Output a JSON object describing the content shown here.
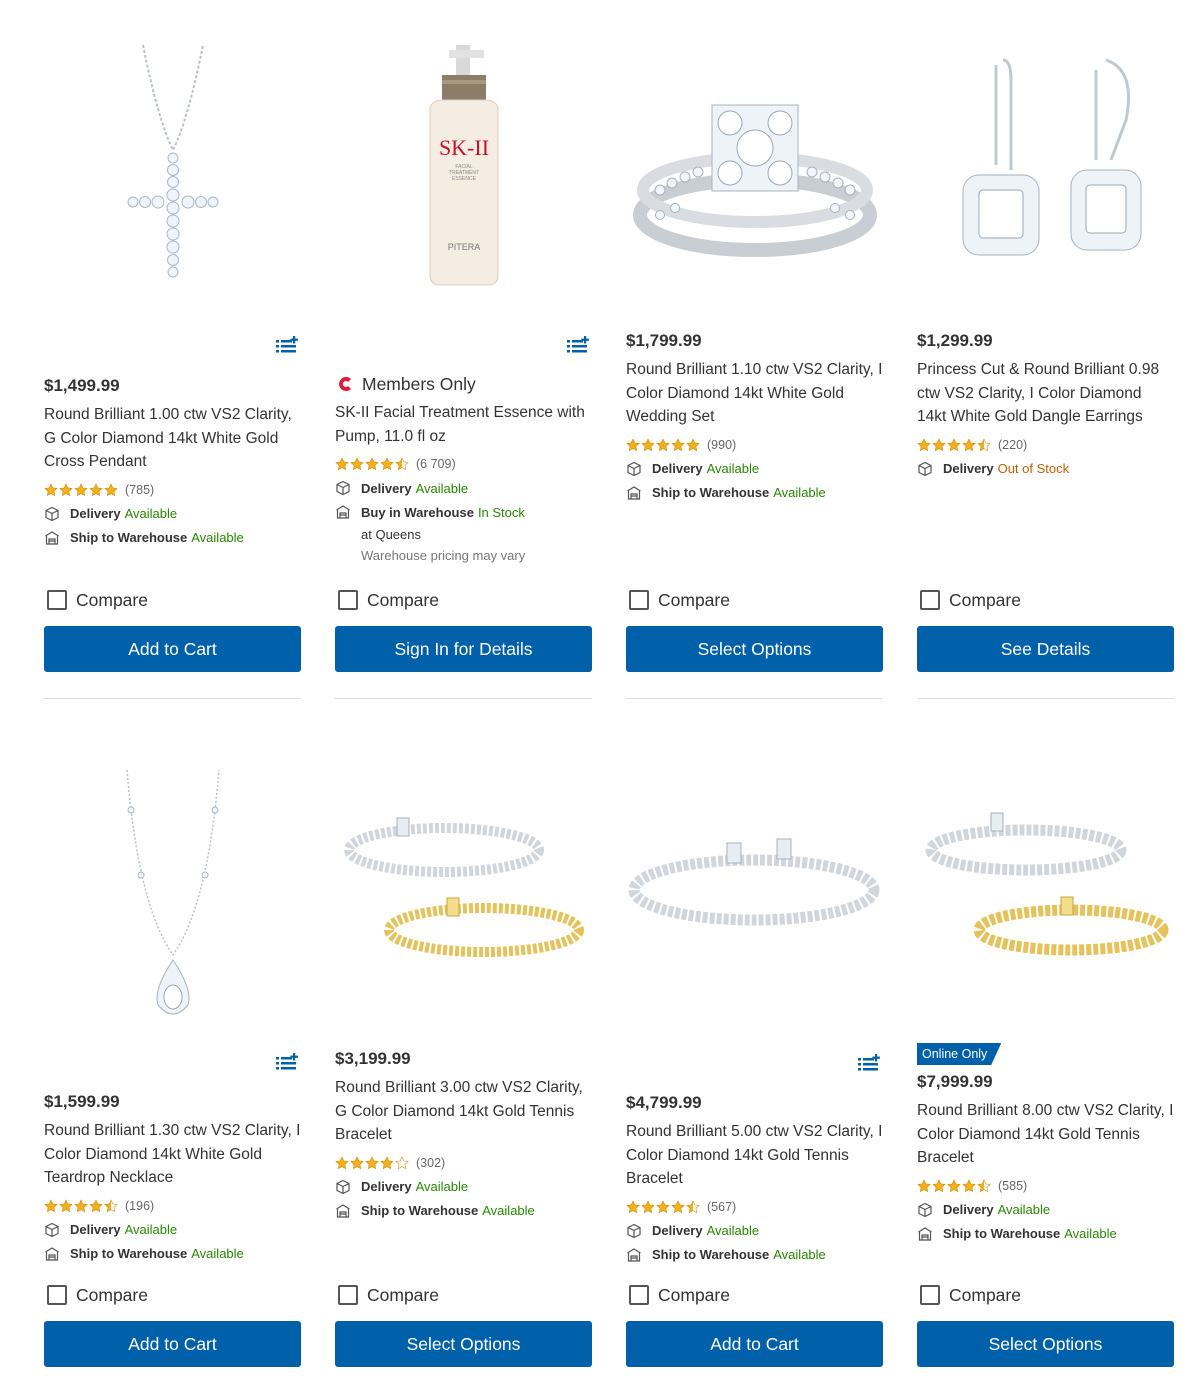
{
  "common": {
    "compare_label": "Compare",
    "delivery_label": "Delivery",
    "ship_label": "Ship to Warehouse",
    "buy_label": "Buy in Warehouse"
  },
  "colors": {
    "button": "#0060a9",
    "available": "#2a8703",
    "out_of_stock": "#c35f00",
    "star": "#f2b01e"
  },
  "products": [
    {
      "price": "$1,499.99",
      "title": "Round Brilliant 1.00 ctw VS2 Clarity, G Color Diamond 14kt White Gold Cross Pendant",
      "rating": 5,
      "reviews": "(785)",
      "delivery": "Available",
      "ship": "Available",
      "button": "Add to Cart",
      "image_icon": "cross-pendant-image"
    },
    {
      "members": "Members Only",
      "title": "SK-II Facial Treatment Essence with Pump, 11.0 fl oz",
      "rating": 4.5,
      "reviews": "(6 709)",
      "delivery": "Available",
      "buy": "In Stock",
      "buy_sub": "at Queens",
      "buy_note": "Warehouse pricing may vary",
      "button": "Sign In for Details",
      "bottle_brand": "SK-II",
      "bottle_line1": "FACIAL",
      "bottle_line2": "TREATMENT",
      "bottle_line3": "ESSENCE",
      "bottle_sub": "PITERA"
    },
    {
      "price": "$1,799.99",
      "title": "Round Brilliant 1.10 ctw VS2 Clarity, I Color Diamond 14kt White Gold Wedding Set",
      "rating": 5,
      "reviews": "(990)",
      "delivery": "Available",
      "ship": "Available",
      "button": "Select Options"
    },
    {
      "price": "$1,299.99",
      "title": "Princess Cut & Round Brilliant 0.98 ctw VS2 Clarity, I Color Diamond 14kt White Gold Dangle Earrings",
      "rating": 4.5,
      "reviews": "(220)",
      "delivery": "Out of Stock",
      "button": "See Details"
    },
    {
      "price": "$1,599.99",
      "title": "Round Brilliant 1.30 ctw VS2 Clarity, I Color Diamond 14kt White Gold Teardrop Necklace",
      "rating": 4.5,
      "reviews": "(196)",
      "delivery": "Available",
      "ship": "Available",
      "button": "Add to Cart"
    },
    {
      "price": "$3,199.99",
      "title": "Round Brilliant 3.00 ctw VS2 Clarity, G Color Diamond 14kt Gold Tennis Bracelet",
      "rating": 4,
      "reviews": "(302)",
      "delivery": "Available",
      "ship": "Available",
      "button": "Select Options"
    },
    {
      "price": "$4,799.99",
      "title": "Round Brilliant 5.00 ctw VS2 Clarity, I Color Diamond 14kt Gold Tennis Bracelet",
      "rating": 4.5,
      "reviews": "(567)",
      "delivery": "Available",
      "ship": "Available",
      "button": "Add to Cart"
    },
    {
      "badge": "Online Only",
      "price": "$7,999.99",
      "title": "Round Brilliant 8.00 ctw VS2 Clarity, I Color Diamond 14kt Gold Tennis Bracelet",
      "rating": 4.5,
      "reviews": "(585)",
      "delivery": "Available",
      "ship": "Available",
      "button": "Select Options"
    }
  ]
}
